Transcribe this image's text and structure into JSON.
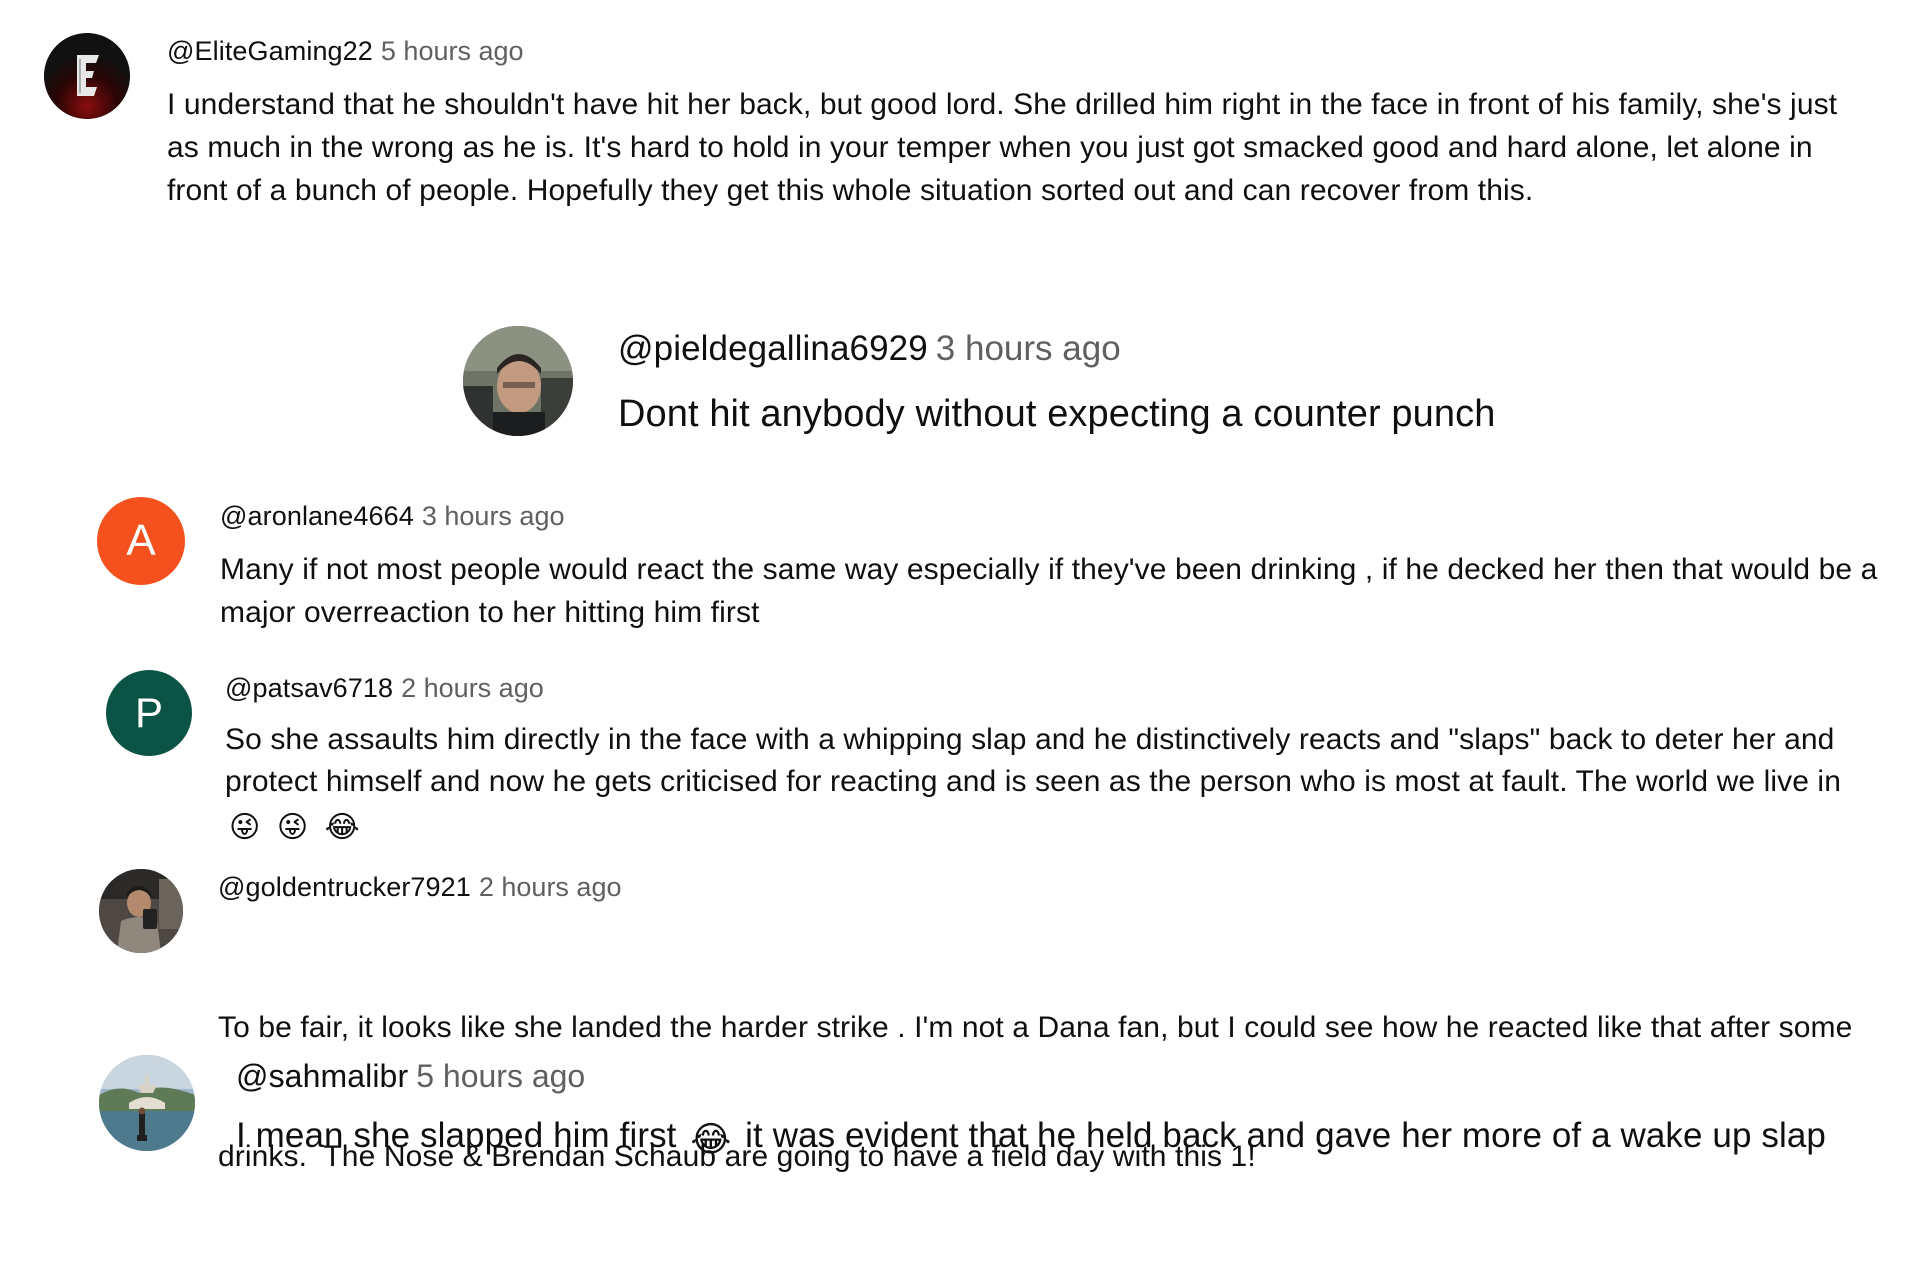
{
  "comments": [
    {
      "handle": "@EliteGaming22",
      "time": "5 hours ago",
      "text": "I understand that he shouldn't have hit her back, but good lord. She drilled him right in the face in front of his family, she's just as much in the wrong as he is. It's hard to hold in your temper when you just got smacked good and hard alone, let alone in front of a bunch of people. Hopefully they get this whole situation sorted out and can recover from this.",
      "avatar": {
        "type": "logo",
        "letter": "E",
        "color": "#1a1a1a",
        "accent": "#7a0000"
      }
    },
    {
      "handle": "@pieldegallina6929",
      "time": "3 hours ago",
      "text": "Dont hit anybody without expecting a counter punch",
      "avatar": {
        "type": "photo",
        "icon": "person-photo-icon"
      }
    },
    {
      "handle": "@aronlane4664",
      "time": "3 hours ago",
      "text": "Many if not most people would react the same way especially if they've been drinking , if he decked her then that would be a major overreaction to her hitting him first",
      "avatar": {
        "type": "letter",
        "letter": "A",
        "color": "#f4511e"
      }
    },
    {
      "handle": "@patsav6718",
      "time": "2 hours ago",
      "text": "So she assaults him directly in the face with a whipping slap and he distinctively reacts and \"slaps\" back to deter her and protect himself and now he gets criticised for reacting and is seen as the person who is most at fault. The world we live in",
      "emojis": [
        "😜",
        "😜",
        "😂"
      ],
      "avatar": {
        "type": "letter",
        "letter": "P",
        "color": "#0b5345"
      }
    },
    {
      "handle": "@goldentrucker7921",
      "time": "2 hours ago",
      "text_line1": "To be fair, it looks like she landed the harder strike . I'm not a Dana fan, but I could see how he reacted like that after some",
      "text_line2": "drinks.  The Nose & Brendan Schaub are going to have a field day with this 1!",
      "avatar": {
        "type": "photo",
        "icon": "person-photo-icon"
      }
    },
    {
      "handle": "@sahmalibr",
      "time": "5 hours ago",
      "text_before": "I mean she slapped him first",
      "emoji": "😂",
      "text_after": "it was evident that he held back and gave her more of a wake up slap",
      "avatar": {
        "type": "photo",
        "icon": "fountain-photo-icon"
      }
    }
  ]
}
